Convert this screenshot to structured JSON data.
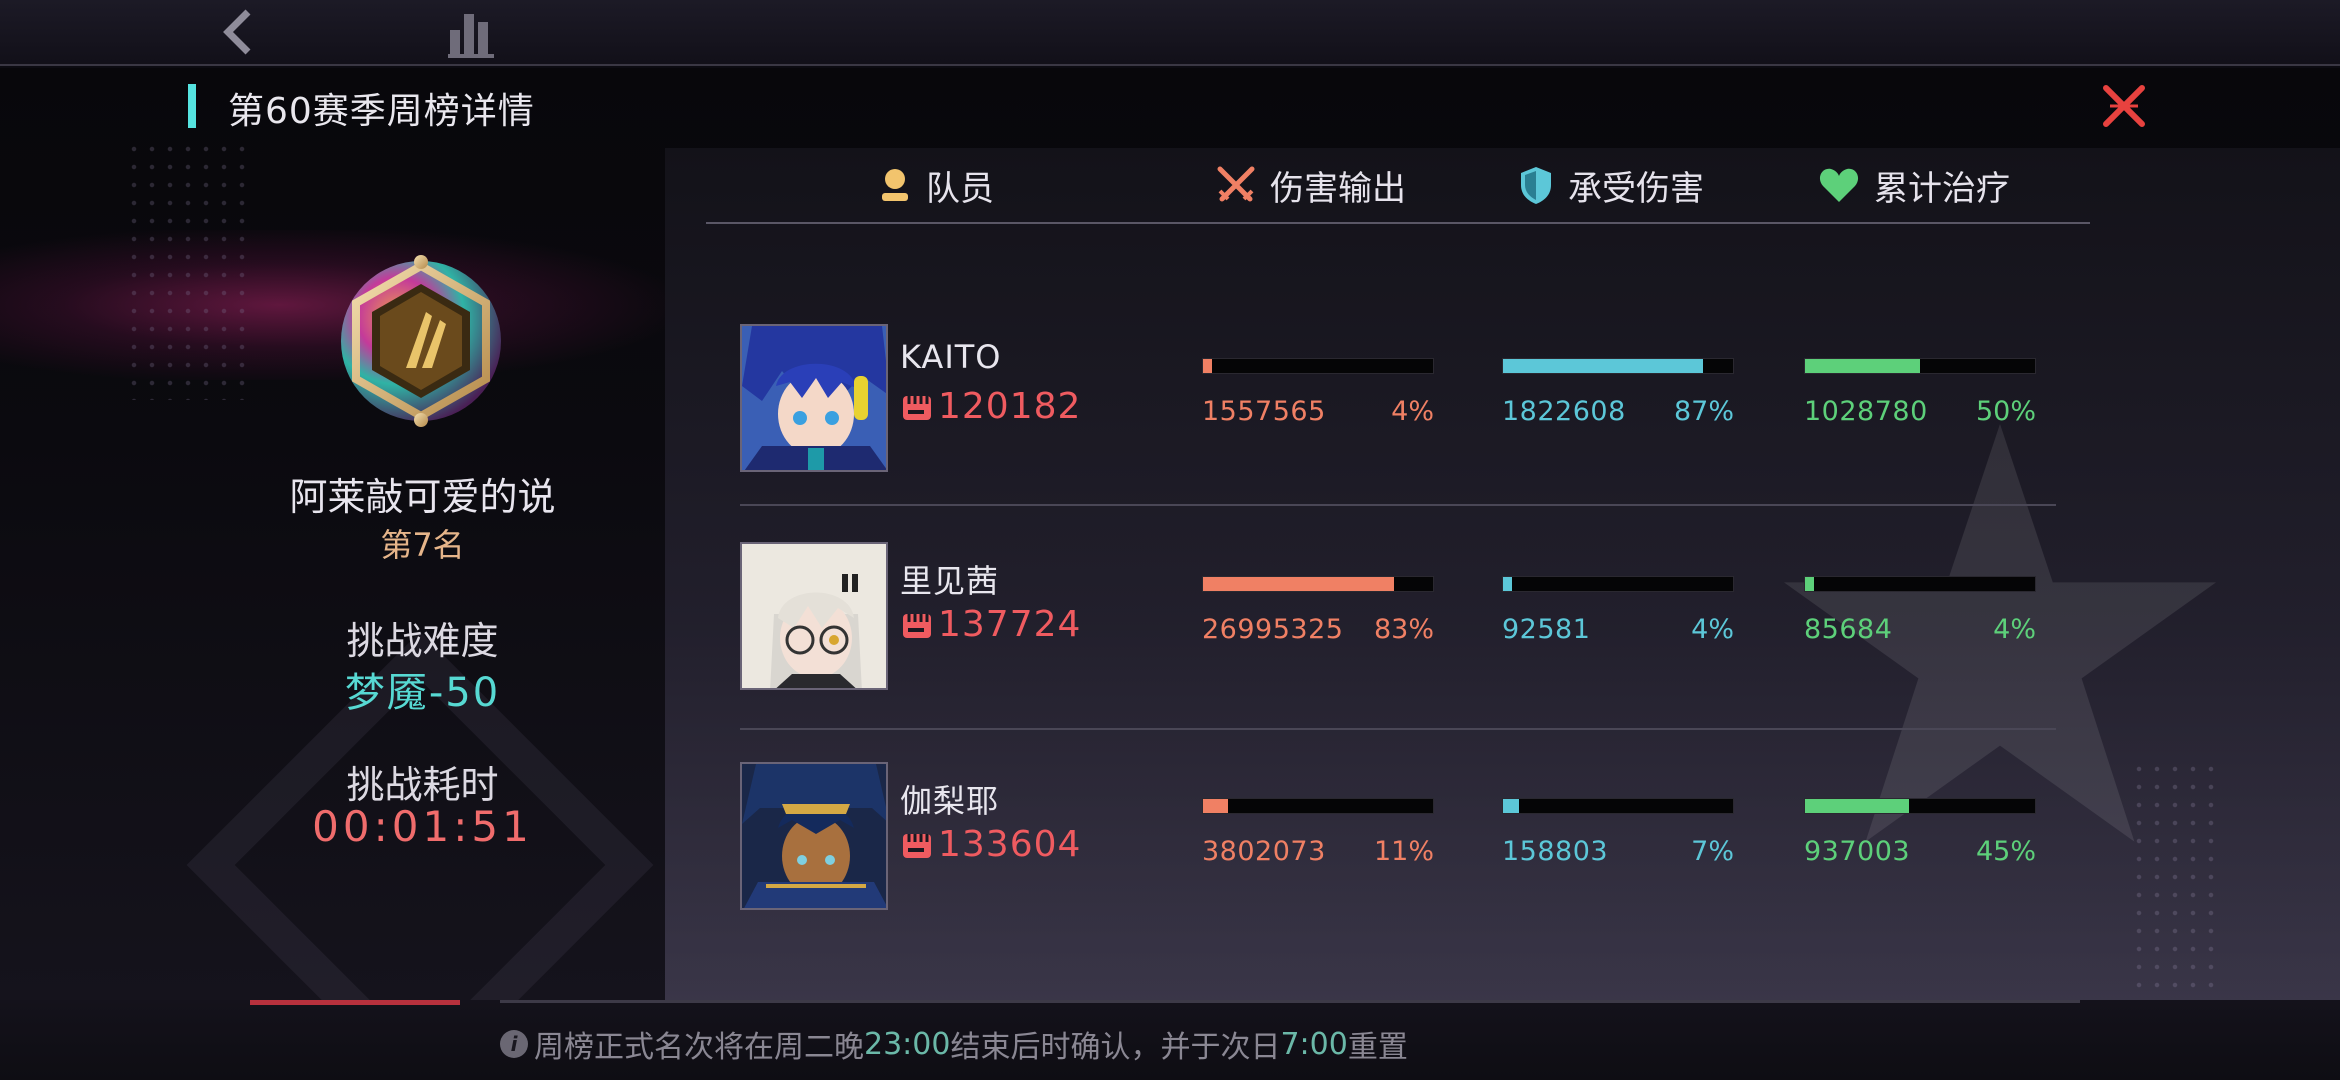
{
  "modal": {
    "title": "第60赛季周榜详情"
  },
  "player": {
    "name": "阿莱敲可爱的说",
    "rank": "第7名",
    "difficulty_label": "挑战难度",
    "difficulty_value": "梦魇-50",
    "time_label": "挑战耗时",
    "time_value": "00:01:51"
  },
  "columns": {
    "member": "队员",
    "damage_dealt": "伤害输出",
    "damage_taken": "承受伤害",
    "healing": "累计治疗"
  },
  "colors": {
    "damage_dealt": "#f08064",
    "damage_taken": "#5cc7d8",
    "healing": "#5dd07a",
    "accent": "#55e3e0",
    "close": "#e8423f",
    "power": "#ef5b60"
  },
  "members": [
    {
      "name": "KAITO",
      "power": "120182",
      "avatar_icon": "kaito-portrait",
      "damage_dealt": {
        "value": "1557565",
        "pct": "4%",
        "fraction": 0.04
      },
      "damage_taken": {
        "value": "1822608",
        "pct": "87%",
        "fraction": 0.87
      },
      "healing": {
        "value": "1028780",
        "pct": "50%",
        "fraction": 0.5
      }
    },
    {
      "name": "里见茜",
      "power": "137724",
      "avatar_icon": "akane-portrait",
      "damage_dealt": {
        "value": "26995325",
        "pct": "83%",
        "fraction": 0.83
      },
      "damage_taken": {
        "value": "92581",
        "pct": "4%",
        "fraction": 0.04
      },
      "healing": {
        "value": "85684",
        "pct": "4%",
        "fraction": 0.04
      }
    },
    {
      "name": "伽梨耶",
      "power": "133604",
      "avatar_icon": "kariye-portrait",
      "damage_dealt": {
        "value": "3802073",
        "pct": "11%",
        "fraction": 0.11
      },
      "damage_taken": {
        "value": "158803",
        "pct": "7%",
        "fraction": 0.07
      },
      "healing": {
        "value": "937003",
        "pct": "45%",
        "fraction": 0.45
      }
    }
  ],
  "footer": {
    "notice_prefix": "周榜正式名次将在周二晚 ",
    "notice_time1": "23:00",
    "notice_mid": "结束后时确认，并于次日 ",
    "notice_time2": "7:00",
    "notice_suffix": " 重置"
  }
}
